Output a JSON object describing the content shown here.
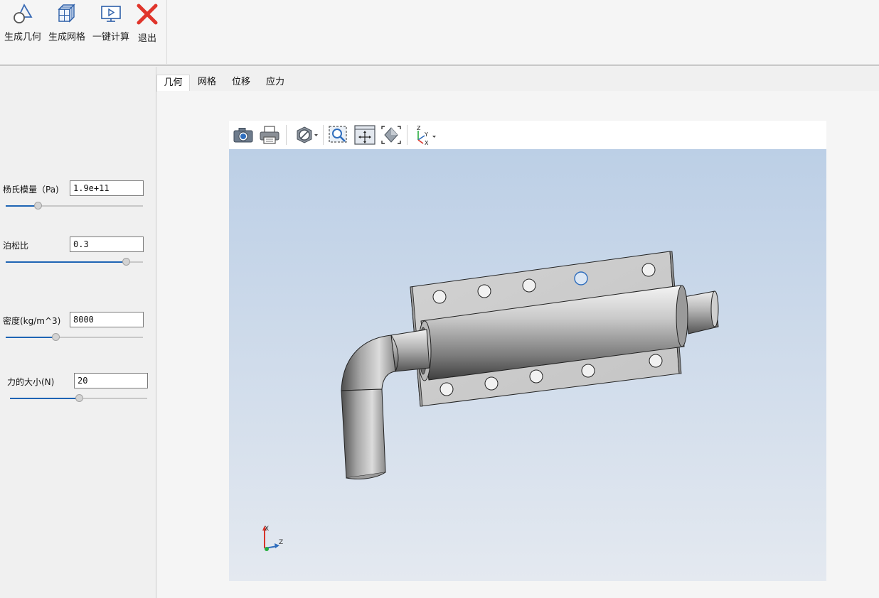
{
  "toolbar": {
    "generate_geometry": "生成几何",
    "generate_mesh": "生成网格",
    "one_click_compute": "一键计算",
    "exit": "退出"
  },
  "params": {
    "youngs_modulus": {
      "label": "杨氏模量（Pa)",
      "value": "1.9e+11",
      "slider": 0.24
    },
    "poisson_ratio": {
      "label": "泊松比",
      "value": "0.3",
      "slider": 0.88
    },
    "density": {
      "label": "密度(kg/m^3)",
      "value": "8000",
      "slider": 0.37
    },
    "force": {
      "label": "力的大小(N)",
      "value": "20",
      "slider": 0.51
    }
  },
  "tabs": [
    "几何",
    "网格",
    "位移",
    "应力"
  ],
  "active_tab": 0,
  "viewer": {
    "tool_icons": [
      "camera-icon",
      "print-icon",
      "display-mode-icon",
      "zoom-box-icon",
      "pan-icon",
      "fit-all-icon",
      "view-axes-icon"
    ],
    "view_axes": {
      "z": "Z",
      "y": "Y",
      "x": "X"
    },
    "triad": {
      "x": "X",
      "z": "Z"
    },
    "background_top": "#bccfe6",
    "background_bottom": "#e4e9f0"
  }
}
